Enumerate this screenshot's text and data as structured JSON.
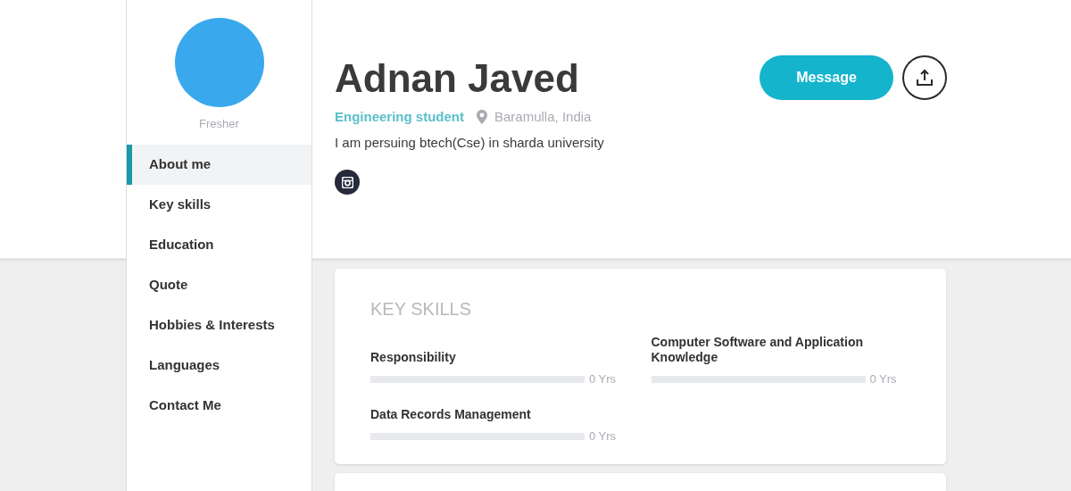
{
  "profile": {
    "status": "Fresher",
    "name": "Adnan Javed",
    "headline": "Engineering student",
    "location": "Baramulla, India",
    "bio": "I am persuing btech(Cse) in sharda university"
  },
  "sidebar": {
    "items": [
      {
        "label": "About me",
        "selected": true
      },
      {
        "label": "Key skills",
        "selected": false
      },
      {
        "label": "Education",
        "selected": false
      },
      {
        "label": "Quote",
        "selected": false
      },
      {
        "label": "Hobbies & Interests",
        "selected": false
      },
      {
        "label": "Languages",
        "selected": false
      },
      {
        "label": "Contact Me",
        "selected": false
      }
    ]
  },
  "actions": {
    "message_button": "Message"
  },
  "key_skills": {
    "title": "KEY SKILLS",
    "skills": [
      {
        "name": "Responsibility",
        "level": 0,
        "reading": "0 Yrs"
      },
      {
        "name": "Computer Software and Application Knowledge",
        "level": 0,
        "reading": "0 Yrs"
      },
      {
        "name": "Data Records Management",
        "level": 0,
        "reading": "0 Yrs"
      }
    ]
  }
}
